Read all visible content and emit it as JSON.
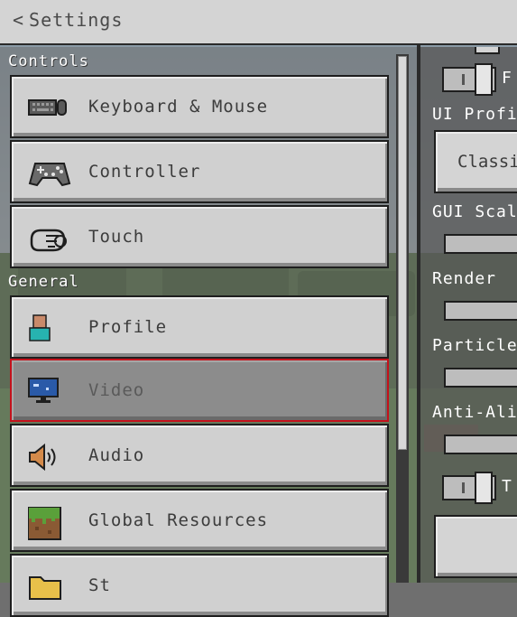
{
  "header": {
    "title": "Settings",
    "back_glyph": "<"
  },
  "sections": {
    "controls_label": "Controls",
    "general_label": "General"
  },
  "nav": {
    "keyboard_mouse": "Keyboard & Mouse",
    "controller": "Controller",
    "touch": "Touch",
    "profile": "Profile",
    "video": "Video",
    "audio": "Audio",
    "global_resources": "Global Resources",
    "storage_partial": "St"
  },
  "selected_item": "Video",
  "right": {
    "toggle1_letter": "F",
    "ui_profile_label": "UI Profi",
    "ui_profile_value": "Classi",
    "gui_scale_label": "GUI Scal",
    "render_label": "Render",
    "particle_label": "Particle",
    "anti_alias_label": "Anti-Alia",
    "toggle2_letter": "T"
  },
  "colors": {
    "selection_outline": "#c4121c",
    "button_bg": "#d0d0d0",
    "selected_bg": "#8c8c8c"
  },
  "icons": {
    "back": "chevron-left-icon",
    "keyboard_mouse": "keyboard-mouse-icon",
    "controller": "gamepad-icon",
    "touch": "touch-hand-icon",
    "profile": "profile-avatar-icon",
    "video": "monitor-icon",
    "audio": "speaker-icon",
    "global_resources": "grass-block-icon",
    "storage": "folder-icon"
  }
}
